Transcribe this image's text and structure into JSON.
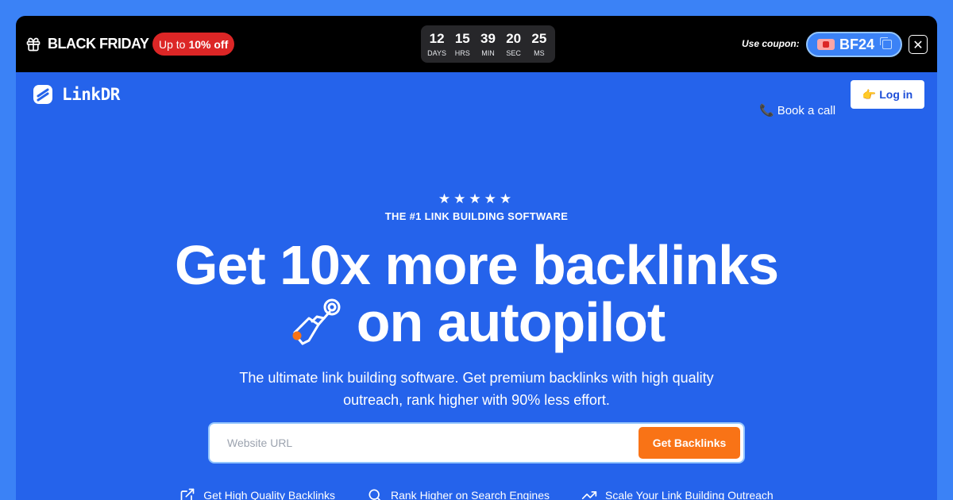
{
  "promo": {
    "title": "BLACK FRIDAY",
    "badge_prefix": "Up to",
    "badge_value": "10% off",
    "countdown": [
      {
        "num": "12",
        "label": "DAYS"
      },
      {
        "num": "15",
        "label": "HRS"
      },
      {
        "num": "39",
        "label": "MIN"
      },
      {
        "num": "20",
        "label": "SEC"
      },
      {
        "num": "25",
        "label": "MS"
      }
    ],
    "coupon_label": "Use coupon:",
    "coupon_code": "BF24",
    "close_symbol": "✕"
  },
  "nav": {
    "logo_text": "LinkDR",
    "book_call_icon": "📞",
    "book_call": "Book a call",
    "login_icon": "👉",
    "login": "Log in"
  },
  "hero": {
    "stars": "★★★★★",
    "eyebrow": "THE #1 LINK BUILDING SOFTWARE",
    "headline_line1": "Get 10x more backlinks",
    "headline_line2": "on autopilot",
    "subtitle": "The ultimate link building software. Get premium backlinks with high quality outreach, rank higher with 90% less effort.",
    "input_placeholder": "Website URL",
    "cta": "Get Backlinks"
  },
  "features": [
    {
      "icon": "external-link-icon",
      "label": "Get High Quality Backlinks"
    },
    {
      "icon": "search-icon",
      "label": "Rank Higher on Search Engines"
    },
    {
      "icon": "trending-up-icon",
      "label": "Scale Your Link Building Outreach"
    }
  ],
  "colors": {
    "page_bg": "#3b82f6",
    "hero_bg": "#2563eb",
    "promo_bg": "#000000",
    "badge_red": "#dc2626",
    "cta_orange": "#f97316"
  }
}
